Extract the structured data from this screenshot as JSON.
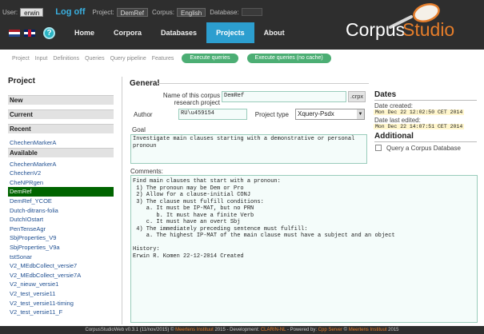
{
  "header": {
    "user_label": "User:",
    "user_value": "erwin",
    "logout": "Log off",
    "project_label": "Project:",
    "project_value": "DemRef",
    "corpus_label": "Corpus:",
    "corpus_value": "English",
    "database_label": "Database:",
    "database_value": "",
    "help": "?",
    "nav": [
      "Home",
      "Corpora",
      "Databases",
      "Projects",
      "About"
    ],
    "active_nav": "Projects",
    "logo_part1": "Corpus",
    "logo_part2": "Studio",
    "colors": {
      "dark": "#2e2e2e",
      "accent": "#2c9ecf",
      "logo_orange": "#e57d2a"
    }
  },
  "toolbar": {
    "links": [
      "Project",
      "Input",
      "Definitions",
      "Queries",
      "Query pipeline",
      "Features"
    ],
    "run": "Execute queries",
    "run_nocache": "Execute queries (no cache)",
    "button_color": "#4cae74"
  },
  "sidebar": {
    "title": "Project",
    "new": "New",
    "current": "Current",
    "recent": "Recent",
    "recent_items": [
      "ChechenMarkerA"
    ],
    "available": "Available",
    "items": [
      "ChechenMarkerA",
      "ChechenV2",
      "CheNPRgen",
      "DemRef",
      "DemRef_YCOE",
      "Dutch-ditrans-folia",
      "DutchIOstart",
      "PenTenseAgr",
      "SbjProperties_V9",
      "SbjProperties_V9a",
      "tstSonar",
      "V2_MEdbCollect_versie7",
      "V2_MEdbCollect_versie7A",
      "V2_nieuw_versie1",
      "V2_test_versie11",
      "V2_test_versie11-timing",
      "V2_test_versie11_F"
    ],
    "selected": "DemRef",
    "selected_color": "#006400"
  },
  "general": {
    "title": "General",
    "name_label": "Name of this corpus research project",
    "name_value": "DemRef",
    "name_suffix": ".crpx",
    "author_label": "Author",
    "author_value": "RU\\u459154",
    "ptype_label": "Project type",
    "ptype_value": "Xquery-Psdx",
    "goal_label": "Goal",
    "goal_value": "Investigate main clauses starting with a demonstrative or personal\npronoun",
    "comments_label": "Comments:",
    "comments_value": "Find main clauses that start with a pronoun:\n 1) The pronoun may be Dem or Pro\n 2) Allow for a clause-initial CONJ\n 3) The clause must fulfill conditions:\n    a. It must be IP-MAT, but no PRN\n       b. It must have a finite Verb\n    c. It must have an overt Sbj\n 4) The immediately preceding sentence must fulfill:\n    a. The highest IP-MAT of the main clause must have a subject and an object\n\nHistory:\nErwin R. Komen 22-12-2014 Created"
  },
  "dates": {
    "title": "Dates",
    "created_label": "Date created:",
    "created_value": "Mon Dec 22 12:02:50 CET 2014",
    "edited_label": "Date last edited:",
    "edited_value": "Mon Dec 22 14:07:51 CET 2014"
  },
  "additional": {
    "title": "Additional",
    "checkbox_label": "Query a Corpus Database",
    "checked": false
  },
  "footer": {
    "text_a": "CorpusStudioWeb v0.3.1 (11/nov/2015) © ",
    "meertens1": "Meertens Instituut",
    "text_b": " 2015 - Development: ",
    "clarin": "CLARIN-NL",
    "text_c": " - Powered by: ",
    "cpp": "Cpp Server",
    "text_d": " © ",
    "meertens2": "Meertens Instituut",
    "text_e": " 2015"
  }
}
